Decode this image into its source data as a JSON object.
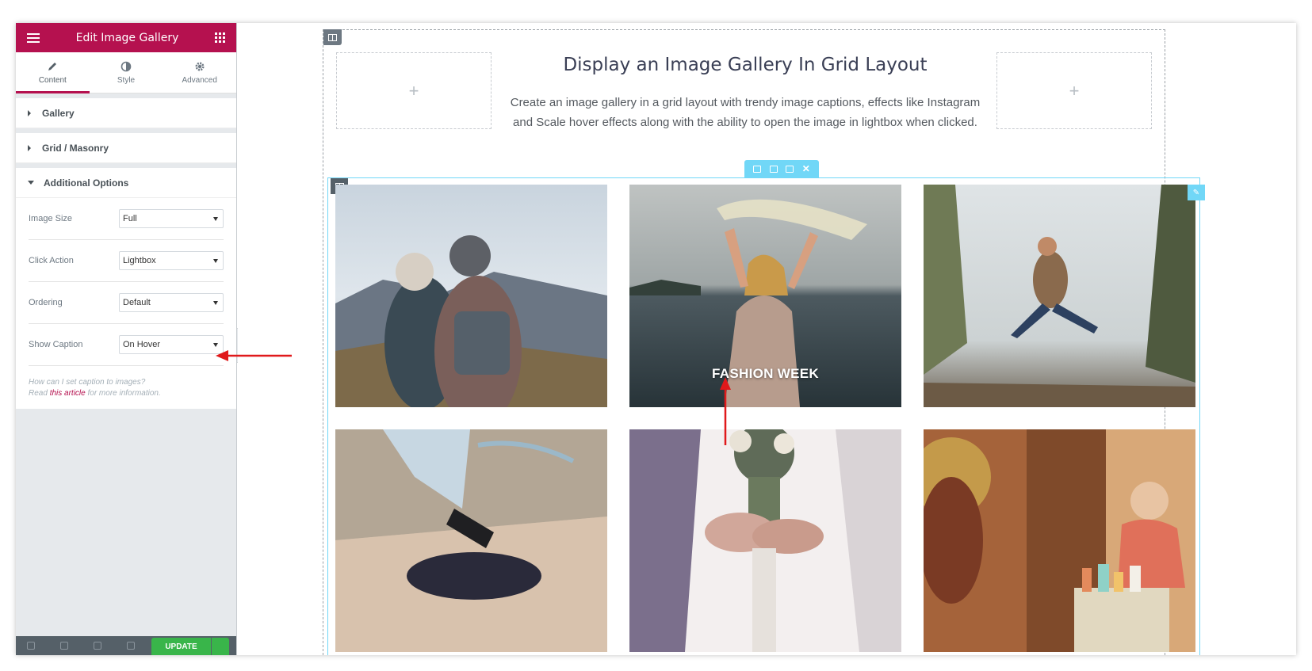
{
  "panel": {
    "title": "Edit Image Gallery",
    "tabs": [
      {
        "label": "Content",
        "icon": "pencil-icon"
      },
      {
        "label": "Style",
        "icon": "contrast-icon"
      },
      {
        "label": "Advanced",
        "icon": "gear-icon"
      }
    ],
    "sections": [
      {
        "label": "Gallery"
      },
      {
        "label": "Grid / Masonry"
      },
      {
        "label": "Additional Options"
      }
    ],
    "options": [
      {
        "label": "Image Size",
        "value": "Full"
      },
      {
        "label": "Click Action",
        "value": "Lightbox"
      },
      {
        "label": "Ordering",
        "value": "Default"
      },
      {
        "label": "Show Caption",
        "value": "On Hover"
      }
    ],
    "help": {
      "line1": "How can I set caption to images?",
      "prefix": "Read ",
      "link": "this article",
      "suffix": " for more information."
    },
    "footer": {
      "update_label": "UPDATE"
    },
    "accent": "#b5114f"
  },
  "canvas": {
    "heading": "Display an Image Gallery In Grid Layout",
    "description_line1": "Create an image gallery in a grid layout with trendy image captions, effects like Instagram",
    "description_line2": "and Scale hover effects along with the ability to open the image in lightbox when clicked.",
    "add_symbol": "+",
    "gallery": {
      "images": [
        {
          "name": "friends-mountain-view"
        },
        {
          "name": "woman-scarf-sea",
          "caption": "FASHION WEEK"
        },
        {
          "name": "jumping-hiker"
        },
        {
          "name": "skateboarder"
        },
        {
          "name": "wedding-bouquet"
        },
        {
          "name": "woman-mirror"
        }
      ]
    }
  }
}
